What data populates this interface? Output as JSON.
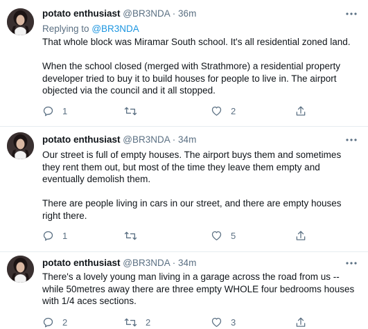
{
  "tweets": [
    {
      "name": "potato enthusiast",
      "handle": "@BR3NDA",
      "separator": "·",
      "time": "36m",
      "replying_prefix": "Replying to",
      "replying_handle": "@BR3NDA",
      "paragraphs": [
        "That whole block was Miramar South school. It's all residential zoned land.",
        "When the school closed (merged with Strathmore) a residential property developer tried to buy it to build houses for people to live in. The airport objected via the council and it all stopped."
      ],
      "reply_count": "1",
      "retweet_count": "",
      "like_count": "2"
    },
    {
      "name": "potato enthusiast",
      "handle": "@BR3NDA",
      "separator": "·",
      "time": "34m",
      "paragraphs": [
        "Our street is full of empty houses. The airport buys them and sometimes they rent them out, but most of the time they leave them empty and eventually demolish them.",
        "There are people living in cars in our street, and there are empty houses right there."
      ],
      "reply_count": "1",
      "retweet_count": "",
      "like_count": "5"
    },
    {
      "name": "potato enthusiast",
      "handle": "@BR3NDA",
      "separator": "·",
      "time": "34m",
      "paragraphs": [
        "There's a lovely young man living in a garage across the road from us -- while 50metres away there are three empty WHOLE four bedrooms houses with 1/4 aces sections."
      ],
      "reply_count": "2",
      "retweet_count": "2",
      "like_count": "3"
    }
  ],
  "icons": {
    "reply": "reply-icon",
    "retweet": "retweet-icon",
    "like": "heart-icon",
    "share": "share-icon",
    "more": "more-icon"
  },
  "colors": {
    "text": "#0f1419",
    "secondary": "#5b7083",
    "link": "#1b95e0",
    "divider": "#e6ecf0"
  }
}
